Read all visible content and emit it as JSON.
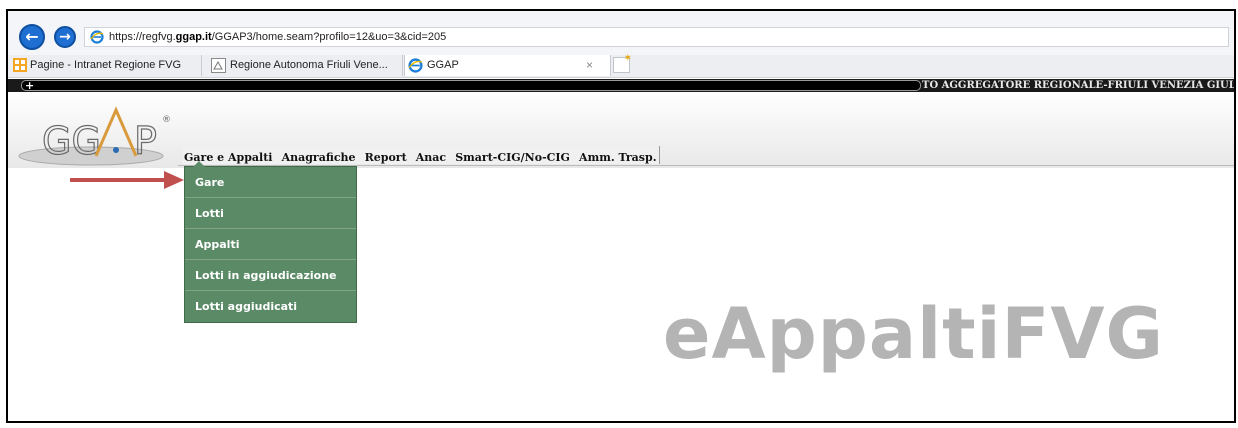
{
  "browser": {
    "url_prefix": "https://regfvg.",
    "url_domain": "ggap.it",
    "url_rest": "/GGAP3/home.seam?profilo=12&uo=3&cid=205",
    "tabs": [
      {
        "label": "Pagine - Intranet Regione FVG",
        "icon": "intranet-icon"
      },
      {
        "label": "Regione Autonoma Friuli Vene...",
        "icon": "regione-icon"
      },
      {
        "label": "GGAP",
        "icon": "ie-icon"
      }
    ],
    "close_glyph": "×"
  },
  "header": {
    "title": "TO AGGREGATORE REGIONALE-FRIULI VENEZIA GIULIA",
    "logo_text": "GG",
    "logo_text2": "P",
    "logo_mark": "®"
  },
  "menu": {
    "items": [
      "Gare e Appalti",
      "Anagrafiche",
      "Report",
      "Anac",
      "Smart-CIG/No-CIG",
      "Amm. Trasp."
    ]
  },
  "dropdown": {
    "items": [
      "Gare",
      "Lotti",
      "Appalti",
      "Lotti in aggiudicazione",
      "Lotti aggiudicati"
    ]
  },
  "brand": "eAppaltiFVG",
  "colors": {
    "dropdown_bg": "#5b8a67",
    "arrow": "#c0504d",
    "brand": "#b4b4b4"
  }
}
